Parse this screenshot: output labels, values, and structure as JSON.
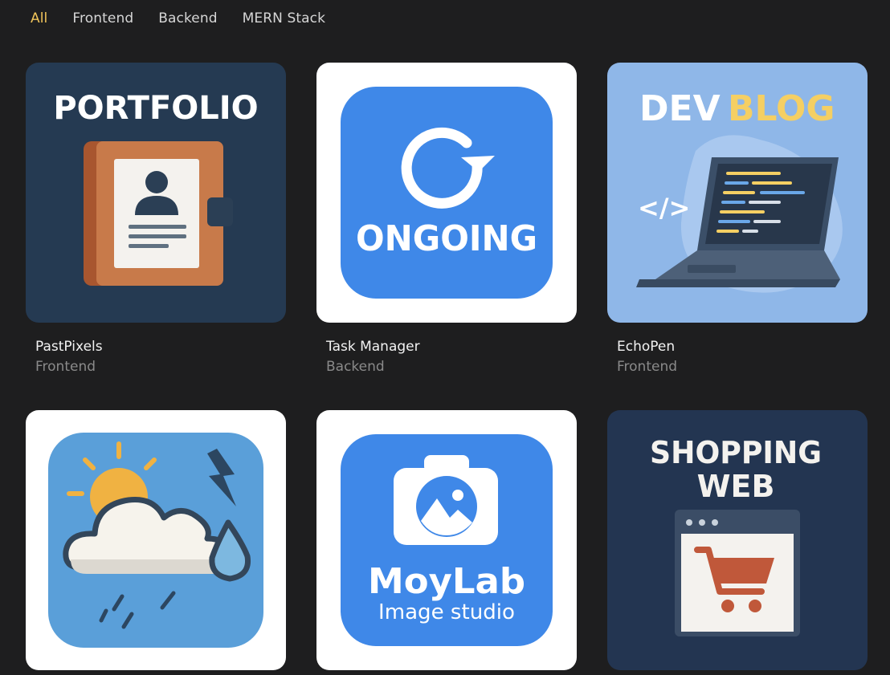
{
  "filters": [
    {
      "label": "All",
      "active": true
    },
    {
      "label": "Frontend",
      "active": false
    },
    {
      "label": "Backend",
      "active": false
    },
    {
      "label": "MERN Stack",
      "active": false
    }
  ],
  "projects": [
    {
      "title": "PastPixels",
      "category": "Frontend",
      "image_text": "PORTFOLIO"
    },
    {
      "title": "Task Manager",
      "category": "Backend",
      "image_text": "ONGOING"
    },
    {
      "title": "EchoPen",
      "category": "Frontend",
      "image_text_1": "DEV",
      "image_text_2": "BLOG",
      "code_glyph": "</>"
    },
    {
      "title": "",
      "category": ""
    },
    {
      "title": "",
      "category": "",
      "image_text_1": "MoyLab",
      "image_text_2": "Image studio"
    },
    {
      "title": "",
      "category": "",
      "image_text_1": "SHOPPING",
      "image_text_2": "WEB"
    }
  ],
  "colors": {
    "accent": "#f0c45a",
    "background": "#1e1e1f"
  }
}
